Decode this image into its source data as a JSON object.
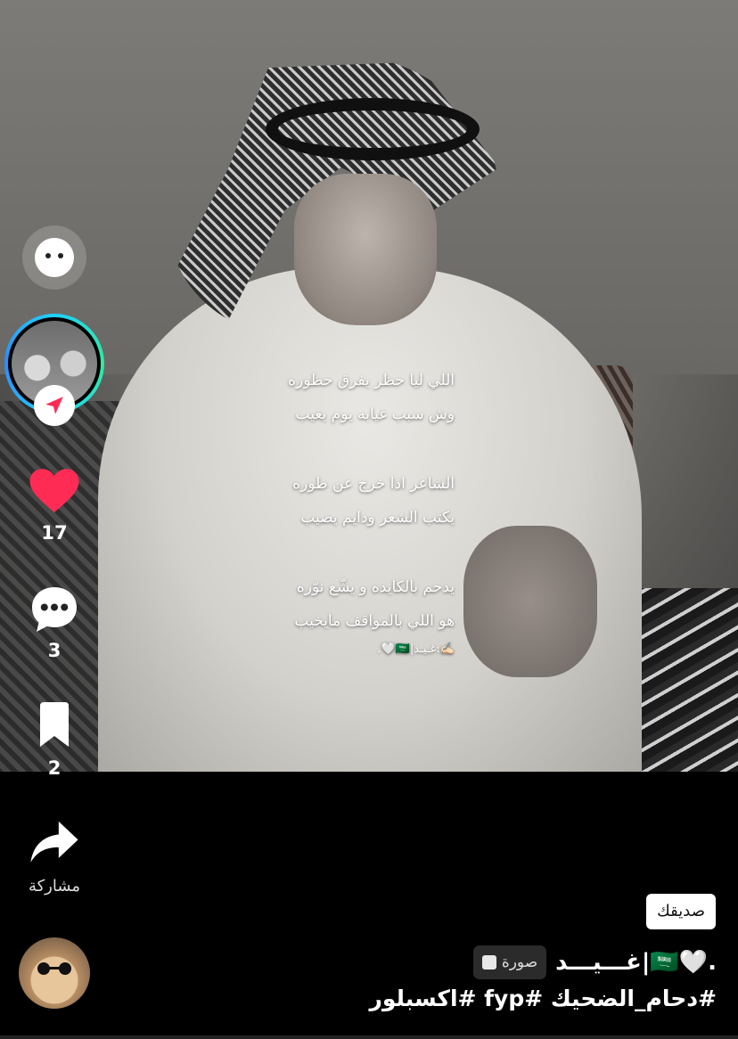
{
  "post": {
    "caption_lines": [
      "اللي ليا حظر يفرق حظوره",
      "وش سبب غيابه يوم يغيب",
      "الشاعر اذا خرج عن طوره",
      "يكتب الشعر ودايم يصيب",
      "يدحم بالكايده و يشّع نوّره",
      "هو اللي بالمواقف مايخيب"
    ],
    "signature": "✍🏻:غـيـد|🇸🇦🤍."
  },
  "sidebar": {
    "likes": "17",
    "comments": "3",
    "saves": "2",
    "share_label": "مشاركة"
  },
  "footer": {
    "friend_badge": "صديقك",
    "username": "غـــيـــد|🇸🇦🤍.",
    "photo_tag": "صورة",
    "hashtags": "#دحام_الضحيك #fyp #اكسبلور"
  },
  "colors": {
    "like": "#fe2c55",
    "ring": "#1fd1f9",
    "badge_plane": "#fe2c55"
  },
  "icons": [
    "face-filter-icon",
    "send-plane-icon",
    "heart-icon",
    "comment-icon",
    "bookmark-icon",
    "share-arrow-icon",
    "photo-icon"
  ]
}
